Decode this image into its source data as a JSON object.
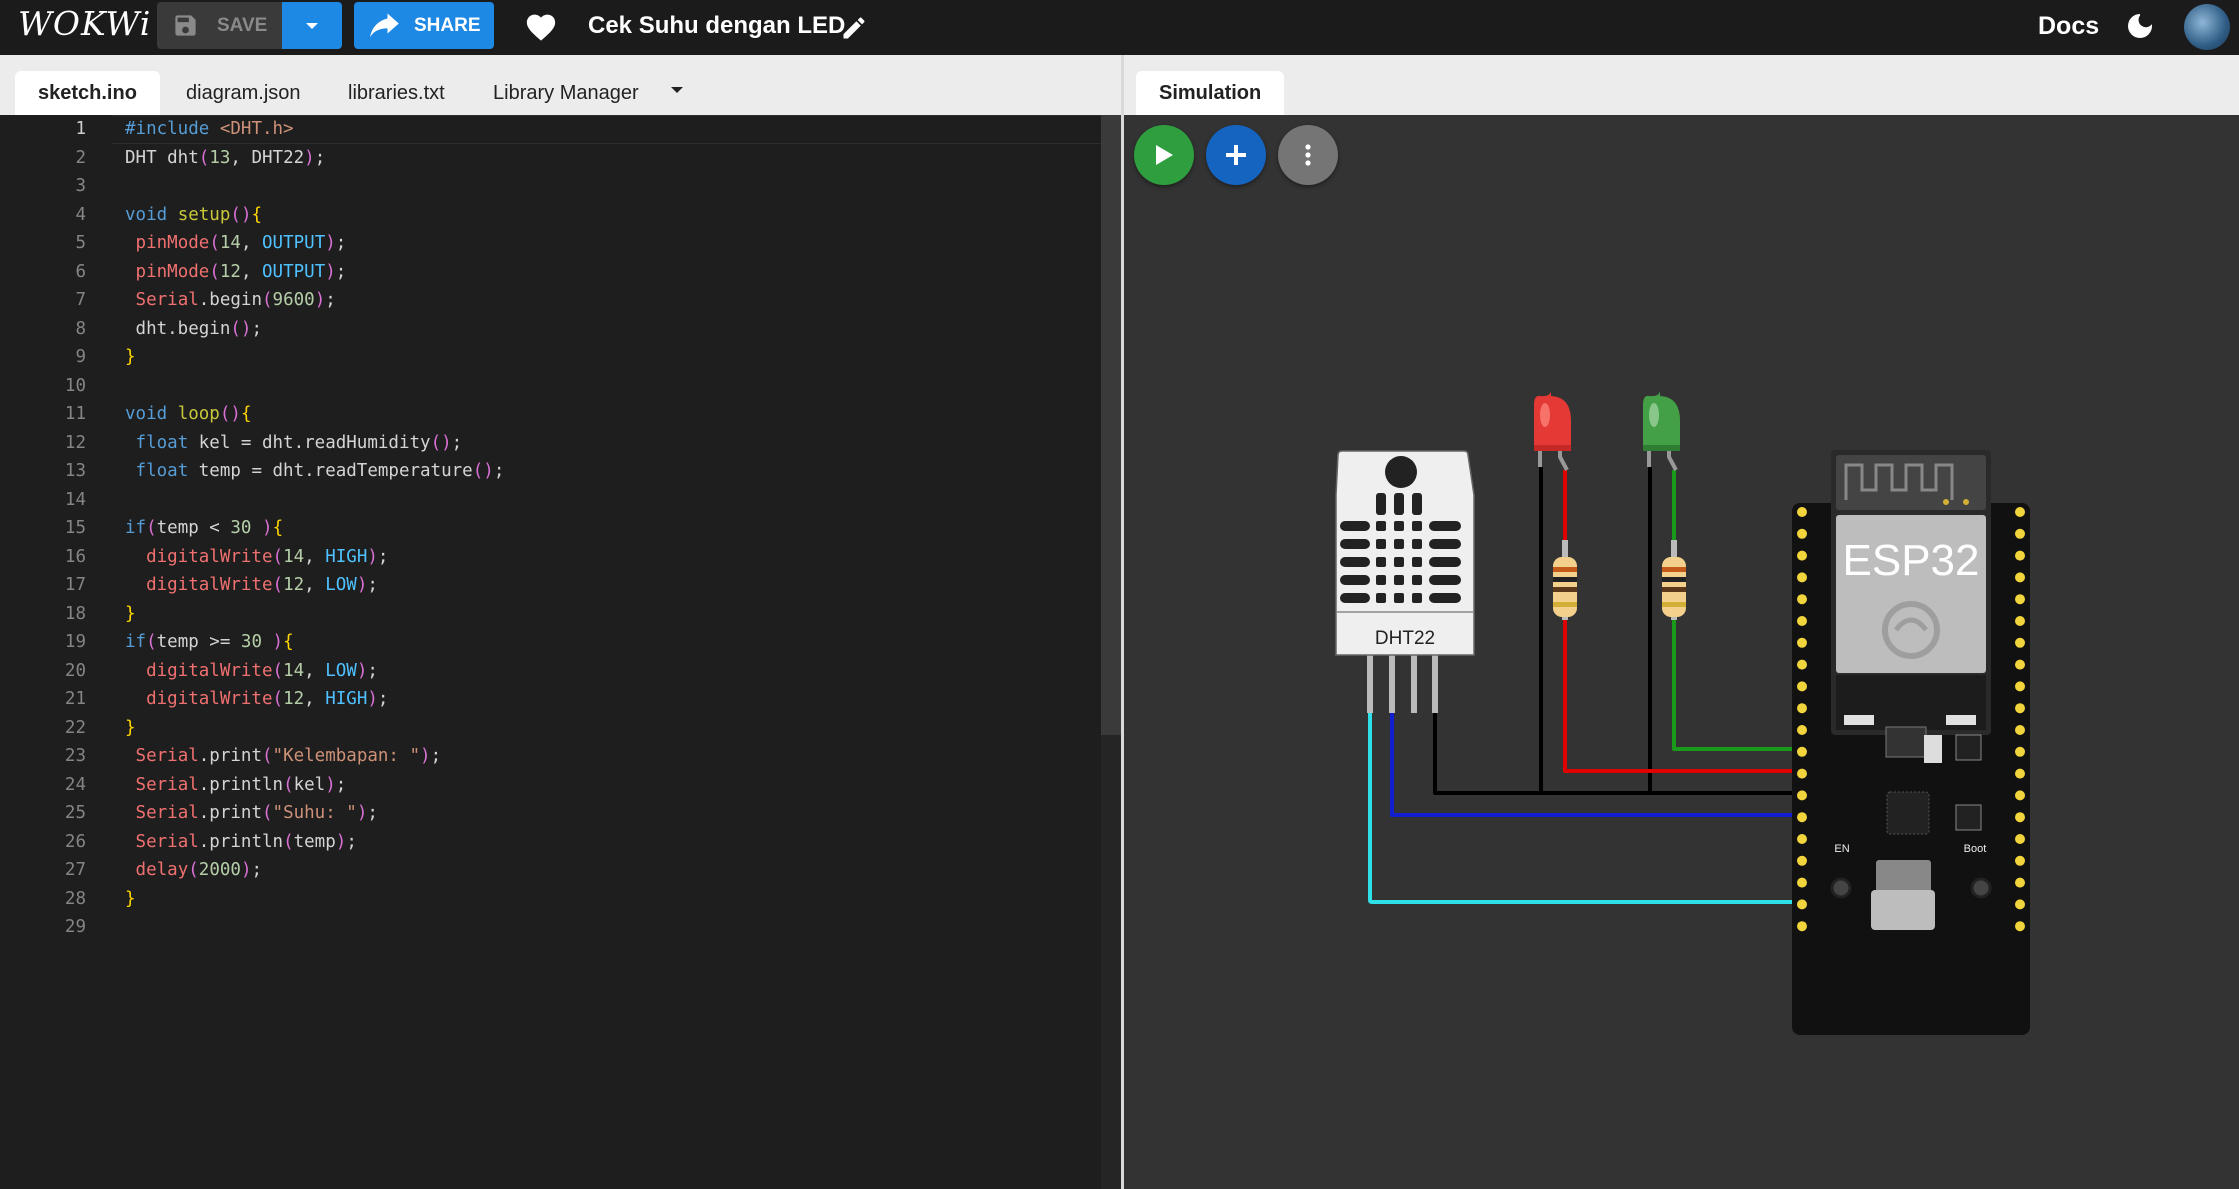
{
  "header": {
    "logo": "WOKWi",
    "save_label": "SAVE",
    "share_label": "SHARE",
    "project_title": "Cek Suhu dengan LED",
    "docs_label": "Docs"
  },
  "editor": {
    "tabs": [
      "sketch.ino",
      "diagram.json",
      "libraries.txt",
      "Library Manager"
    ],
    "active_tab": "sketch.ino",
    "line_numbers": [
      "1",
      "2",
      "3",
      "4",
      "5",
      "6",
      "7",
      "8",
      "9",
      "10",
      "11",
      "12",
      "13",
      "14",
      "15",
      "16",
      "17",
      "18",
      "19",
      "20",
      "21",
      "22",
      "23",
      "24",
      "25",
      "26",
      "27",
      "28",
      "29"
    ],
    "lines": [
      "#include <DHT.h>",
      "DHT dht(13, DHT22);",
      "",
      "void setup(){",
      " pinMode(14, OUTPUT);",
      " pinMode(12, OUTPUT);",
      " Serial.begin(9600);",
      " dht.begin();",
      "}",
      "",
      "void loop(){",
      " float kel = dht.readHumidity();",
      " float temp = dht.readTemperature();",
      "",
      "if(temp < 30 ){",
      "  digitalWrite(14, HIGH);",
      "  digitalWrite(12, LOW);",
      "}",
      "if(temp >= 30 ){",
      "  digitalWrite(14, LOW);",
      "  digitalWrite(12, HIGH);",
      "}",
      " Serial.print(\"Kelembapan: \");",
      " Serial.println(kel);",
      " Serial.print(\"Suhu: \");",
      " Serial.println(temp);",
      " delay(2000);",
      "}",
      ""
    ]
  },
  "simulation": {
    "tab_label": "Simulation",
    "dht_label": "DHT22",
    "board_label": "ESP32",
    "en_label": "EN",
    "boot_label": "Boot",
    "led_colors": {
      "red": "#e53935",
      "green": "#43a047"
    },
    "wire_colors": {
      "black": "#000000",
      "red": "#e00000",
      "green": "#1a9a1a",
      "blue": "#1020d0",
      "cyan": "#30e0e8"
    }
  }
}
